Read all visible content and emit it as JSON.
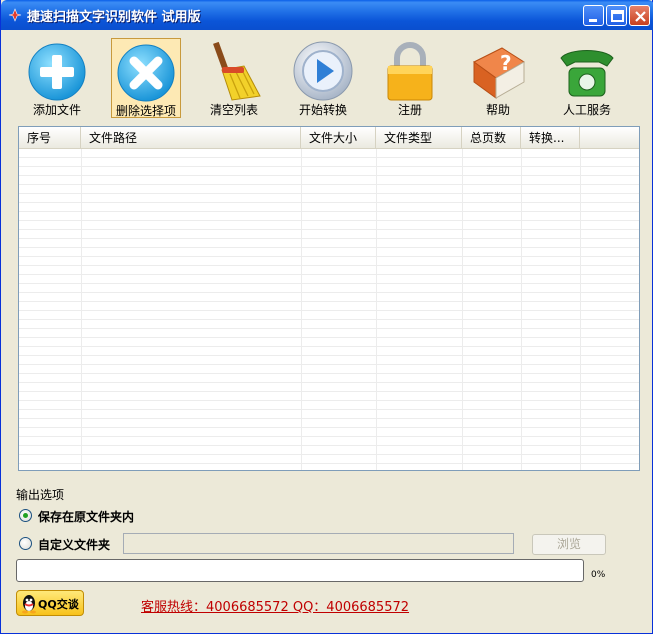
{
  "window": {
    "title": "捷速扫描文字识别软件  试用版"
  },
  "toolbar": {
    "items": [
      {
        "label": "添加文件",
        "icon": "add-icon"
      },
      {
        "label": "删除选择项",
        "icon": "delete-icon"
      },
      {
        "label": "清空列表",
        "icon": "broom-icon"
      },
      {
        "label": "开始转换",
        "icon": "play-icon"
      },
      {
        "label": "注册",
        "icon": "lock-icon"
      },
      {
        "label": "帮助",
        "icon": "help-book-icon"
      },
      {
        "label": "人工服务",
        "icon": "phone-icon"
      }
    ],
    "selected_index": 1
  },
  "file_table": {
    "columns": [
      "序号",
      "文件路径",
      "文件大小",
      "文件类型",
      "总页数",
      "转换..."
    ],
    "rows": []
  },
  "output_options": {
    "title": "输出选项",
    "save_original_label": "保存在原文件夹内",
    "save_original_selected": true,
    "custom_folder_label": "自定义文件夹",
    "custom_folder_value": "",
    "browse_label": "浏览"
  },
  "progress": {
    "percent_text": "0%",
    "value": 0
  },
  "footer": {
    "qq_label": "QQ交谈",
    "hotline": "客服热线：4006685572 QQ：4006685572"
  },
  "colors": {
    "titlebar": "#0a55d8",
    "window_bg": "#ece9d8",
    "hotline": "#c00000",
    "selected_toolbar": "#fde9b4"
  }
}
